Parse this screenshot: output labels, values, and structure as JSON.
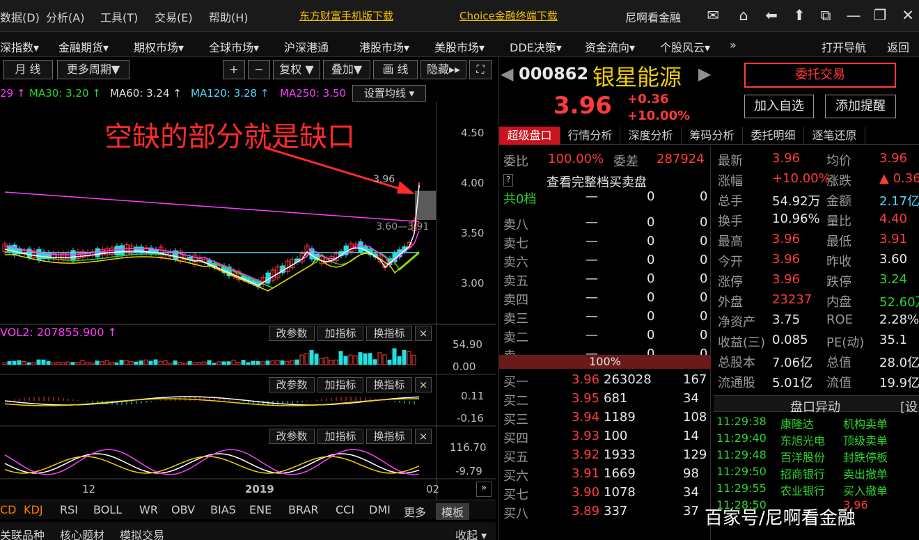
{
  "menu": {
    "items": [
      "数据(D)",
      "分析(A)",
      "工具(T)",
      "交易(E)",
      "帮助(H)"
    ],
    "download1": "东方财富手机版下载",
    "download2": "Choice金融终端下载",
    "user": "尼啊看金融"
  },
  "nav": {
    "items": [
      "深指数▾",
      "金融期货▾",
      "期权市场▾",
      "全球市场▾",
      "沪深港通",
      "港股市场▾",
      "美股市场▾",
      "DDE决策▾",
      "资金流向▾",
      "个股风云▾",
      "»"
    ],
    "open_nav": "打开导航",
    "back": "返回"
  },
  "toolbar": {
    "month": "月 线",
    "more": "更多周期▼",
    "plus": "+",
    "minus": "−",
    "fuquan": "复权 ▼",
    "overlay": "叠加▼",
    "draw": "画 线",
    "hide": "隐藏▸▸",
    "full": "⛶"
  },
  "ma": {
    "ma_cut": "29 ↑",
    "ma30": "MA30: 3.20 ↑",
    "ma60": "MA60: 3.24 ↑",
    "ma120": "MA120: 3.28 ↑",
    "ma250": "MA250: 3.50",
    "setting": "设置均线 ▾"
  },
  "annotation": "空缺的部分就是缺口",
  "price_axis": [
    "4.50",
    "4.00",
    "3.50",
    "3.00"
  ],
  "chart_labels": {
    "high": "3.96",
    "low_high": "3.60—3.91"
  },
  "vol": {
    "label": "VOL2: 207855.900 ↑",
    "axis": [
      "54.90",
      "0.00"
    ]
  },
  "macd": {
    "axis": [
      "0.11",
      "-0.16"
    ]
  },
  "kdj": {
    "axis": [
      "116.70",
      "-9.79"
    ]
  },
  "subbuttons": [
    "改参数",
    "加指标",
    "换指标",
    "×"
  ],
  "time_axis": {
    "t1": "12",
    "t2": "2019",
    "t3": "02"
  },
  "indicators": [
    "CD",
    "KDJ",
    "RSI",
    "BOLL",
    "WR",
    "OBV",
    "BIAS",
    "ENE",
    "BRAR",
    "CCI",
    "DMI",
    "更多",
    "模板"
  ],
  "bottom_tabs": [
    "关联品种",
    "核心题材",
    "模拟交易",
    "收起 ▾"
  ],
  "quote": {
    "code": "000862",
    "name": "银星能源",
    "price": "3.96",
    "chg": "+0.36",
    "pct": "+10.00%",
    "trade_btn": "委托交易",
    "watch_btn": "加入自选",
    "alert_btn": "添加提醒"
  },
  "right_tabs": [
    "超级盘口",
    "行情分析",
    "深度分析",
    "筹码分析",
    "委托明细",
    "逐笔还原"
  ],
  "weibi": {
    "label1": "委比",
    "v1": "100.00%",
    "label2": "委差",
    "v2": "287924"
  },
  "full_depth": "查看完整档买卖盘",
  "gong": {
    "label": "共0档",
    "dash": "—",
    "a": "0",
    "b": "0"
  },
  "sells": [
    [
      "卖八",
      "—",
      "0",
      "0"
    ],
    [
      "卖七",
      "—",
      "0",
      "0"
    ],
    [
      "卖六",
      "—",
      "0",
      "0"
    ],
    [
      "卖五",
      "—",
      "0",
      "0"
    ],
    [
      "卖四",
      "—",
      "0",
      "0"
    ],
    [
      "卖三",
      "—",
      "0",
      "0"
    ],
    [
      "卖二",
      "—",
      "0",
      "0"
    ],
    [
      "卖一",
      "—",
      "0",
      "0"
    ]
  ],
  "mid_pct": "100%",
  "buys": [
    [
      "买一",
      "3.96",
      "263028",
      "167"
    ],
    [
      "买二",
      "3.95",
      "681",
      "34"
    ],
    [
      "买三",
      "3.94",
      "1189",
      "108"
    ],
    [
      "买四",
      "3.93",
      "100",
      "14"
    ],
    [
      "买五",
      "3.92",
      "1933",
      "129"
    ],
    [
      "买六",
      "3.91",
      "1669",
      "98"
    ],
    [
      "买七",
      "3.90",
      "1078",
      "34"
    ],
    [
      "买八",
      "3.89",
      "337",
      "37"
    ]
  ],
  "stats": [
    [
      "最新",
      "3.96",
      "均价",
      "3.96"
    ],
    [
      "涨幅",
      "+10.00%",
      "涨跌",
      "▲ 0.36"
    ],
    [
      "总手",
      "54.92万",
      "金额",
      "2.17亿"
    ],
    [
      "换手",
      "10.96%",
      "量比",
      "4.40"
    ],
    [
      "最高",
      "3.96",
      "最低",
      "3.91"
    ],
    [
      "今开",
      "3.96",
      "昨收",
      "3.60"
    ],
    [
      "涨停",
      "3.96",
      "跌停",
      "3.24"
    ],
    [
      "外盘",
      "23237",
      "内盘",
      "52.60万"
    ],
    [
      "净资产",
      "3.75",
      "ROE",
      "2.28%"
    ],
    [
      "收益(三)",
      "0.085",
      "PE(动)",
      "35.1"
    ],
    [
      "总股本",
      "7.06亿",
      "总值",
      "28.0亿"
    ],
    [
      "流通股",
      "5.01亿",
      "流值",
      "19.9亿"
    ]
  ],
  "events_title": "盘口异动",
  "events_set": "[设",
  "events": [
    [
      "11:29:38",
      "康隆达",
      "机构卖单"
    ],
    [
      "11:29:40",
      "东旭光电",
      "顶级卖单"
    ],
    [
      "11:29:48",
      "百洋股份",
      "封跌停板"
    ],
    [
      "11:29:50",
      "招商银行",
      "卖出撤单"
    ],
    [
      "11:29:55",
      "农业银行",
      "买入撤单"
    ],
    [
      "11:28:50",
      "",
      "3.96"
    ]
  ],
  "watermark": "百家号/尼啊看金融",
  "colors": {
    "up": "#ff3b3b",
    "down": "#22e0e0",
    "ma5": "#ffffff",
    "ma10": "#f0d000",
    "ma20": "#ff3cff",
    "ma30": "#2bd62b",
    "ma60": "#e0e0e0",
    "ma120": "#4fd8ff",
    "ma250": "#ff3cff"
  }
}
